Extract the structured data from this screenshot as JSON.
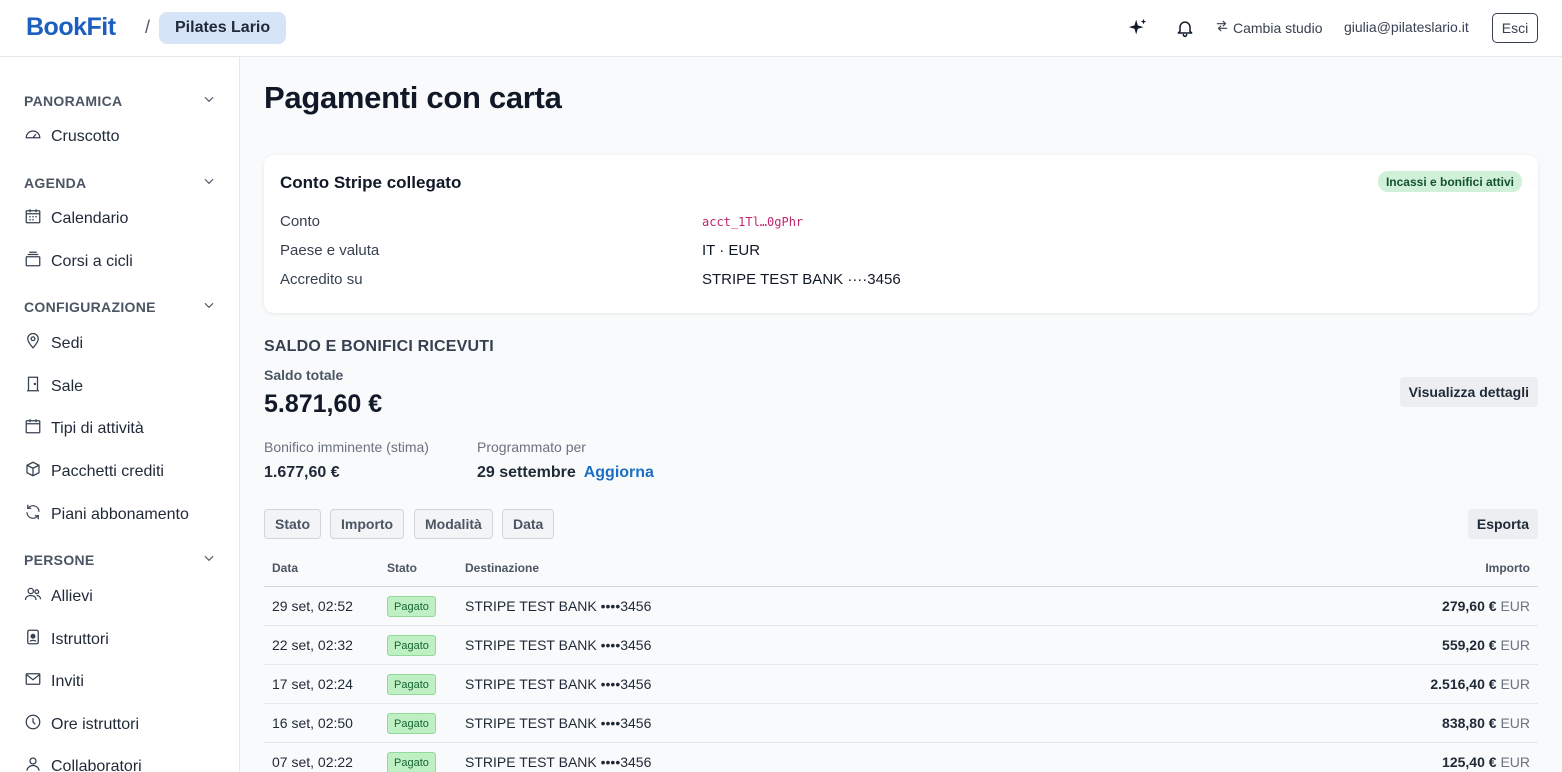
{
  "header": {
    "brand": "BookFit",
    "separator": "/",
    "studio": "Pilates Lario",
    "switch_studio": "Cambia studio",
    "user_email": "giulia@pilateslario.it",
    "logout": "Esci"
  },
  "sidebar": {
    "sections": [
      {
        "title": "PANORAMICA",
        "items": [
          {
            "label": "Cruscotto",
            "icon": "gauge-icon"
          }
        ]
      },
      {
        "title": "AGENDA",
        "items": [
          {
            "label": "Calendario",
            "icon": "calendar-icon"
          },
          {
            "label": "Corsi a cicli",
            "icon": "layers-icon"
          }
        ]
      },
      {
        "title": "CONFIGURAZIONE",
        "items": [
          {
            "label": "Sedi",
            "icon": "map-pin-icon"
          },
          {
            "label": "Sale",
            "icon": "door-icon"
          },
          {
            "label": "Tipi di attività",
            "icon": "calendar-blank-icon"
          },
          {
            "label": "Pacchetti crediti",
            "icon": "package-icon"
          },
          {
            "label": "Piani abbonamento",
            "icon": "refresh-icon"
          }
        ]
      },
      {
        "title": "PERSONE",
        "items": [
          {
            "label": "Allievi",
            "icon": "users-icon"
          },
          {
            "label": "Istruttori",
            "icon": "id-badge-icon"
          },
          {
            "label": "Inviti",
            "icon": "mail-icon"
          },
          {
            "label": "Ore istruttori",
            "icon": "clock-icon"
          },
          {
            "label": "Collaboratori",
            "icon": "user-icon"
          }
        ]
      }
    ]
  },
  "page": {
    "title": "Pagamenti con carta"
  },
  "account_card": {
    "title": "Conto Stripe collegato",
    "badge": "Incassi e bonifici attivi",
    "rows": [
      {
        "label": "Conto",
        "value": "acct_1Tl…0gPhr"
      },
      {
        "label": "Paese e valuta",
        "value": "IT · EUR"
      },
      {
        "label": "Accredito su",
        "value": "STRIPE TEST BANK ····3456"
      }
    ]
  },
  "balance": {
    "section_title": "SALDO E BONIFICI RICEVUTI",
    "total_label": "Saldo totale",
    "total_value": "5.871,60 €",
    "details_button": "Visualizza dettagli",
    "upcoming_label": "Bonifico imminente (stima)",
    "upcoming_value": "1.677,60 €",
    "scheduled_label": "Programmato per",
    "scheduled_value": "29 settembre",
    "refresh_link": "Aggiorna"
  },
  "filters": [
    "Stato",
    "Importo",
    "Modalità",
    "Data"
  ],
  "export_button": "Esporta",
  "table": {
    "columns": {
      "date": "Data",
      "status": "Stato",
      "destination": "Destinazione",
      "amount": "Importo"
    },
    "rows": [
      {
        "date": "29 set, 02:52",
        "status": "Pagato",
        "destination": "STRIPE TEST BANK ••••3456",
        "amount": "279,60 €",
        "currency": "EUR"
      },
      {
        "date": "22 set, 02:32",
        "status": "Pagato",
        "destination": "STRIPE TEST BANK ••••3456",
        "amount": "559,20 €",
        "currency": "EUR"
      },
      {
        "date": "17 set, 02:24",
        "status": "Pagato",
        "destination": "STRIPE TEST BANK ••••3456",
        "amount": "2.516,40 €",
        "currency": "EUR"
      },
      {
        "date": "16 set, 02:50",
        "status": "Pagato",
        "destination": "STRIPE TEST BANK ••••3456",
        "amount": "838,80 €",
        "currency": "EUR"
      },
      {
        "date": "07 set, 02:22",
        "status": "Pagato",
        "destination": "STRIPE TEST BANK ••••3456",
        "amount": "125,40 €",
        "currency": "EUR"
      }
    ]
  }
}
